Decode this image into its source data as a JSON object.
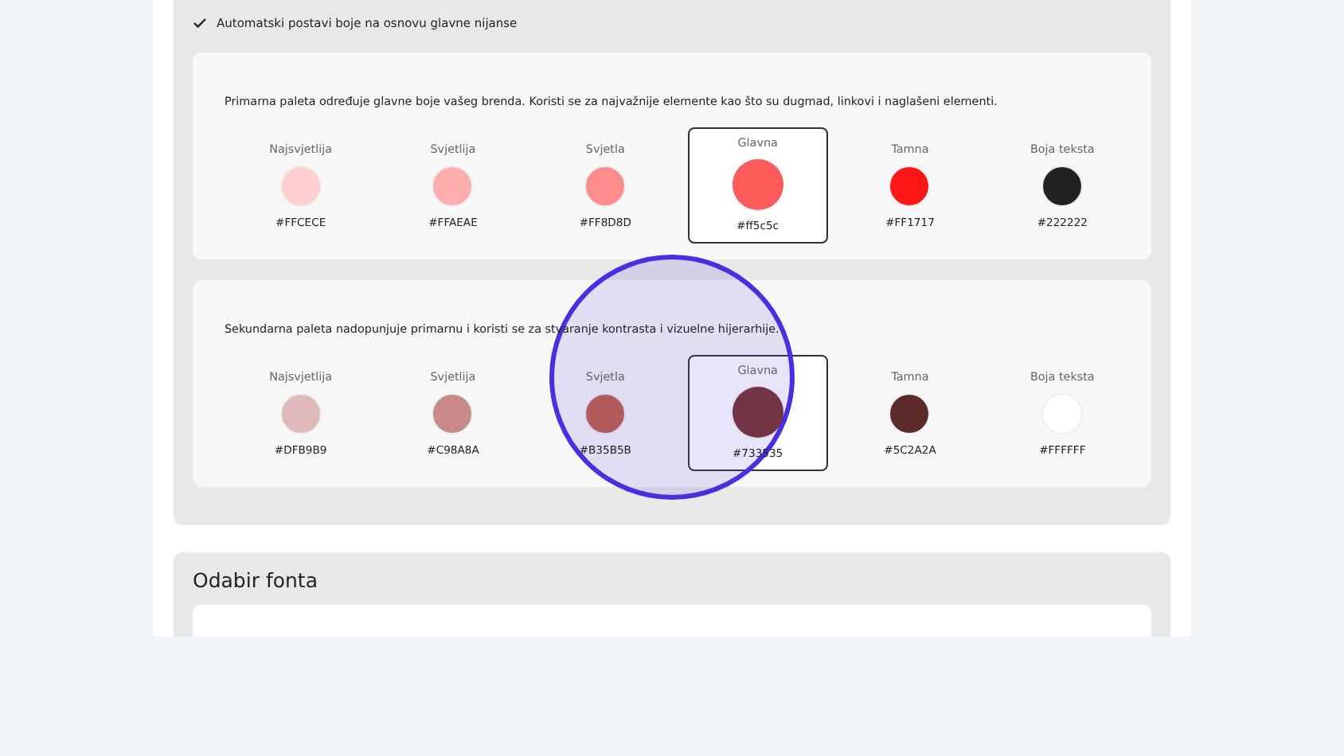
{
  "auto_colors": {
    "label": "Automatski postavi boje na osnovu glavne nijanse",
    "checked": true
  },
  "palettes": [
    {
      "description": "Primarna paleta određuje glavne boje vašeg brenda. Koristi se za najvažnije elemente kao što su dugmad, linkovi i naglašeni elementi.",
      "swatches": [
        {
          "label": "Najsvjetlija",
          "hex": "#FFCECE",
          "color": "#ffcece",
          "selected": false
        },
        {
          "label": "Svjetlija",
          "hex": "#FFAEAE",
          "color": "#ffaeae",
          "selected": false
        },
        {
          "label": "Svjetla",
          "hex": "#FF8D8D",
          "color": "#ff8d8d",
          "selected": false
        },
        {
          "label": "Glavna",
          "hex": "#ff5c5c",
          "color": "#ff5c5c",
          "selected": true
        },
        {
          "label": "Tamna",
          "hex": "#FF1717",
          "color": "#ff1717",
          "selected": false
        },
        {
          "label": "Boja teksta",
          "hex": "#222222",
          "color": "#222222",
          "selected": false
        }
      ]
    },
    {
      "description": "Sekundarna paleta nadopunjuje primarnu i koristi se za stvaranje kontrasta i vizuelne hijerarhije.",
      "swatches": [
        {
          "label": "Najsvjetlija",
          "hex": "#DFB9B9",
          "color": "#dfb9b9",
          "selected": false
        },
        {
          "label": "Svjetlija",
          "hex": "#C98A8A",
          "color": "#c98a8a",
          "selected": false
        },
        {
          "label": "Svjetla",
          "hex": "#B35B5B",
          "color": "#b35b5b",
          "selected": false
        },
        {
          "label": "Glavna",
          "hex": "#733535",
          "color": "#733545",
          "selected": true
        },
        {
          "label": "Tamna",
          "hex": "#5C2A2A",
          "color": "#5c2a2a",
          "selected": false
        },
        {
          "label": "Boja teksta",
          "hex": "#FFFFFF",
          "color": "#ffffff",
          "selected": false
        }
      ]
    }
  ],
  "font_section": {
    "title": "Odabir fonta"
  },
  "click_highlight": true
}
